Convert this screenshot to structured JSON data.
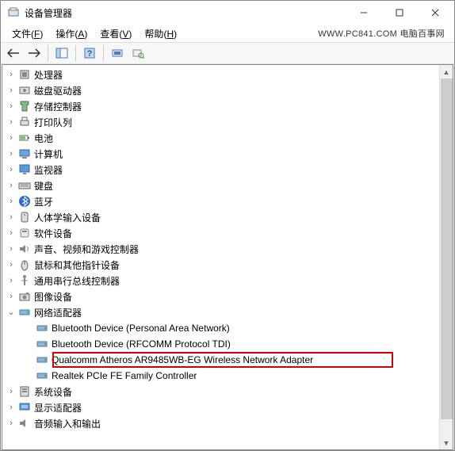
{
  "window": {
    "title": "设备管理器",
    "watermark": "WWW.PC841.COM 电脑百事网"
  },
  "menu": {
    "file": "文件",
    "file_key": "F",
    "action": "操作",
    "action_key": "A",
    "view": "查看",
    "view_key": "V",
    "help": "帮助",
    "help_key": "H"
  },
  "tree": {
    "items": [
      {
        "label": "处理器",
        "icon": "cpu",
        "indent": 1,
        "exp": "closed"
      },
      {
        "label": "磁盘驱动器",
        "icon": "disk",
        "indent": 1,
        "exp": "closed"
      },
      {
        "label": "存储控制器",
        "icon": "storage",
        "indent": 1,
        "exp": "closed"
      },
      {
        "label": "打印队列",
        "icon": "printer",
        "indent": 1,
        "exp": "closed"
      },
      {
        "label": "电池",
        "icon": "battery",
        "indent": 1,
        "exp": "closed"
      },
      {
        "label": "计算机",
        "icon": "computer",
        "indent": 1,
        "exp": "closed"
      },
      {
        "label": "监视器",
        "icon": "monitor",
        "indent": 1,
        "exp": "closed"
      },
      {
        "label": "键盘",
        "icon": "keyboard",
        "indent": 1,
        "exp": "closed"
      },
      {
        "label": "蓝牙",
        "icon": "bluetooth",
        "indent": 1,
        "exp": "closed"
      },
      {
        "label": "人体学输入设备",
        "icon": "hid",
        "indent": 1,
        "exp": "closed"
      },
      {
        "label": "软件设备",
        "icon": "software",
        "indent": 1,
        "exp": "closed"
      },
      {
        "label": "声音、视频和游戏控制器",
        "icon": "sound",
        "indent": 1,
        "exp": "closed"
      },
      {
        "label": "鼠标和其他指针设备",
        "icon": "mouse",
        "indent": 1,
        "exp": "closed"
      },
      {
        "label": "通用串行总线控制器",
        "icon": "usb",
        "indent": 1,
        "exp": "closed"
      },
      {
        "label": "图像设备",
        "icon": "camera",
        "indent": 1,
        "exp": "closed"
      },
      {
        "label": "网络适配器",
        "icon": "network",
        "indent": 1,
        "exp": "open"
      },
      {
        "label": "Bluetooth Device (Personal Area Network)",
        "icon": "netcard",
        "indent": 2,
        "exp": "none"
      },
      {
        "label": "Bluetooth Device (RFCOMM Protocol TDI)",
        "icon": "netcard",
        "indent": 2,
        "exp": "none"
      },
      {
        "label": "Qualcomm Atheros AR9485WB-EG Wireless Network Adapter",
        "icon": "netcard",
        "indent": 2,
        "exp": "none",
        "highlighted": true
      },
      {
        "label": "Realtek PCIe FE Family Controller",
        "icon": "netcard",
        "indent": 2,
        "exp": "none"
      },
      {
        "label": "系统设备",
        "icon": "system",
        "indent": 1,
        "exp": "closed"
      },
      {
        "label": "显示适配器",
        "icon": "display",
        "indent": 1,
        "exp": "closed"
      },
      {
        "label": "音频输入和输出",
        "icon": "audio",
        "indent": 1,
        "exp": "closed"
      }
    ]
  }
}
